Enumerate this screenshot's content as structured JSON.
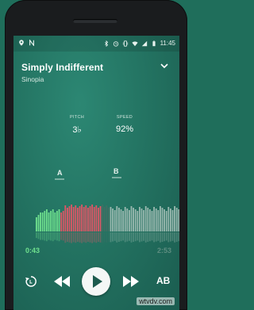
{
  "statusbar": {
    "time": "11:45",
    "left_icons": [
      "location-icon",
      "no-sim-icon"
    ],
    "right_icons": [
      "bluetooth-icon",
      "alarm-icon",
      "vibrate-icon",
      "wifi-icon",
      "signal-icon",
      "battery-icon"
    ]
  },
  "track": {
    "title": "Simply Indifferent",
    "artist": "Sinopia"
  },
  "stats": {
    "pitch_label": "PITCH",
    "pitch_value": "3♭",
    "speed_label": "SPEED",
    "speed_value": "92%"
  },
  "loop": {
    "marker_a": "A",
    "marker_b": "B"
  },
  "playback": {
    "current_time": "0:43",
    "total_time": "2:53",
    "progress_fraction": 0.25
  },
  "controls": {
    "ab_label": "AB"
  },
  "colors": {
    "accent_green": "#6fe08e",
    "loop_red": "#e05566",
    "background": "#22705f"
  },
  "watermark": "wtvdv.com"
}
